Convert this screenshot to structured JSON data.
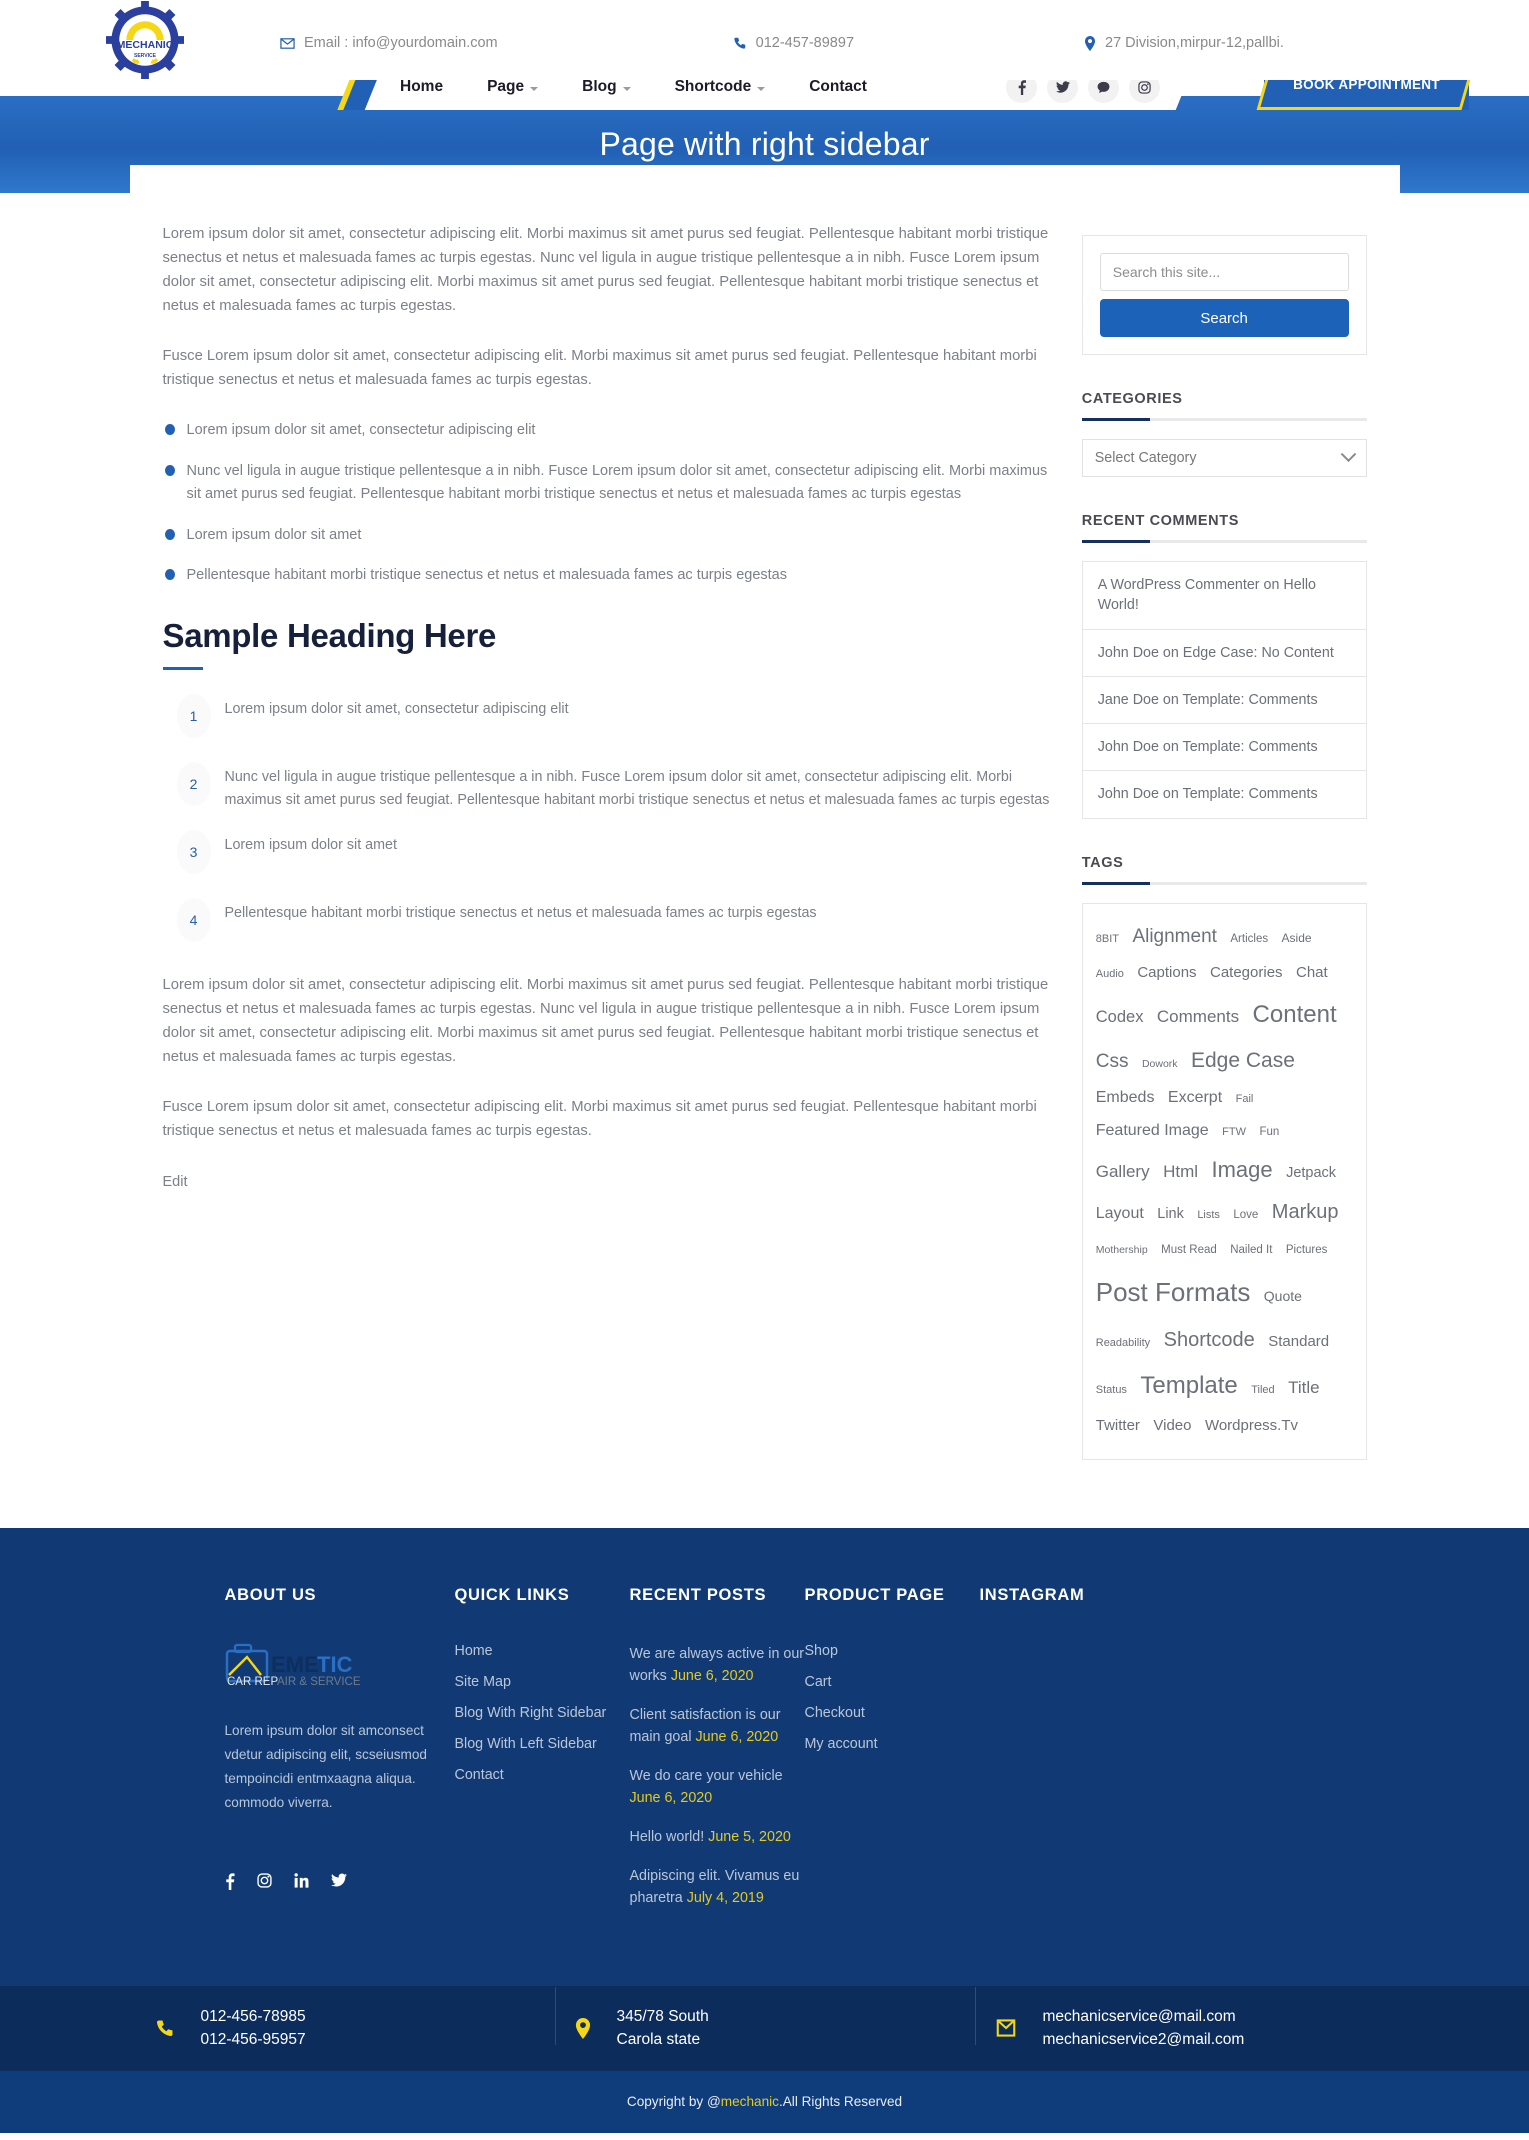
{
  "header": {
    "logo": {
      "brand": "MECHANIC",
      "sub": "SERVICE"
    },
    "contacts": [
      {
        "icon": "mail-icon",
        "text": "Email : info@yourdomain.com"
      },
      {
        "icon": "phone-icon",
        "text": "012-457-89897"
      },
      {
        "icon": "location-pin-icon",
        "text": "27 Division,mirpur-12,pallbi."
      }
    ],
    "nav": [
      {
        "label": "Home",
        "has_dropdown": false
      },
      {
        "label": "Page",
        "has_dropdown": true
      },
      {
        "label": "Blog",
        "has_dropdown": true
      },
      {
        "label": "Shortcode",
        "has_dropdown": true
      },
      {
        "label": "Contact",
        "has_dropdown": false
      }
    ],
    "social": [
      "facebook-icon",
      "twitter-icon",
      "comment-icon",
      "instagram-icon"
    ],
    "cta_label": "BOOK APPOINTMENT"
  },
  "banner": {
    "title": "Page with right sidebar"
  },
  "main": {
    "paragraphs": [
      "Lorem ipsum dolor sit amet, consectetur adipiscing elit. Morbi maximus sit amet purus sed feugiat. Pellentesque habitant morbi tristique senectus et netus et malesuada fames ac turpis egestas. Nunc vel ligula in augue tristique pellentesque a in nibh. Fusce Lorem ipsum dolor sit amet, consectetur adipiscing elit. Morbi maximus sit amet purus sed feugiat. Pellentesque habitant morbi tristique senectus et netus et malesuada fames ac turpis egestas.",
      "Fusce Lorem ipsum dolor sit amet, consectetur adipiscing elit. Morbi maximus sit amet purus sed feugiat. Pellentesque habitant morbi tristique senectus et netus et malesuada fames ac turpis egestas."
    ],
    "bullet_list": [
      "Lorem ipsum dolor sit amet, consectetur adipiscing elit",
      "Nunc vel ligula in augue tristique pellentesque a in nibh. Fusce Lorem ipsum dolor sit amet, consectetur adipiscing elit. Morbi maximus sit amet purus sed feugiat. Pellentesque habitant morbi tristique senectus et netus et malesuada fames ac turpis egestas",
      "Lorem ipsum dolor sit amet",
      "Pellentesque habitant morbi tristique senectus et netus et malesuada fames ac turpis egestas"
    ],
    "heading": "Sample Heading Here",
    "numbered_list": [
      {
        "num": "1",
        "text": "Lorem ipsum dolor sit amet, consectetur adipiscing elit"
      },
      {
        "num": "2",
        "text": "Nunc vel ligula in augue tristique pellentesque a in nibh. Fusce Lorem ipsum dolor sit amet, consectetur adipiscing elit. Morbi maximus sit amet purus sed feugiat. Pellentesque habitant morbi tristique senectus et netus et malesuada fames ac turpis egestas"
      },
      {
        "num": "3",
        "text": "Lorem ipsum dolor sit amet"
      },
      {
        "num": "4",
        "text": "Pellentesque habitant morbi tristique senectus et netus et malesuada fames ac turpis egestas"
      }
    ],
    "paragraphs_after": [
      "Lorem ipsum dolor sit amet, consectetur adipiscing elit. Morbi maximus sit amet purus sed feugiat. Pellentesque habitant morbi tristique senectus et netus et malesuada fames ac turpis egestas. Nunc vel ligula in augue tristique pellentesque a in nibh. Fusce Lorem ipsum dolor sit amet, consectetur adipiscing elit. Morbi maximus sit amet purus sed feugiat. Pellentesque habitant morbi tristique senectus et netus et malesuada fames ac turpis egestas.",
      "Fusce Lorem ipsum dolor sit amet, consectetur adipiscing elit. Morbi maximus sit amet purus sed feugiat. Pellentesque habitant morbi tristique senectus et netus et malesuada fames ac turpis egestas."
    ],
    "edit_label": "Edit"
  },
  "sidebar": {
    "search": {
      "placeholder": "Search this site...",
      "value": "",
      "button_label": "Search"
    },
    "categories": {
      "title": "CATEGORIES",
      "selected": "Select Category"
    },
    "recent_comments": {
      "title": "RECENT COMMENTS",
      "items": [
        "A WordPress Commenter on Hello World!",
        "John Doe on Edge Case: No Content",
        "Jane Doe on Template: Comments",
        "John Doe on Template: Comments",
        "John Doe on Template: Comments"
      ]
    },
    "tags": {
      "title": "TAGS",
      "items": [
        {
          "label": "8BIT",
          "size": 11
        },
        {
          "label": "Alignment",
          "size": 19
        },
        {
          "label": "Articles",
          "size": 11.5
        },
        {
          "label": "Aside",
          "size": 12
        },
        {
          "label": "Audio",
          "size": 11
        },
        {
          "label": "Captions",
          "size": 15
        },
        {
          "label": "Categories",
          "size": 15
        },
        {
          "label": "Chat",
          "size": 15
        },
        {
          "label": "Codex",
          "size": 16.5
        },
        {
          "label": "Comments",
          "size": 17
        },
        {
          "label": "Content",
          "size": 24
        },
        {
          "label": "Css",
          "size": 19
        },
        {
          "label": "Dowork",
          "size": 10.5
        },
        {
          "label": "Edge Case",
          "size": 21
        },
        {
          "label": "Embeds",
          "size": 16
        },
        {
          "label": "Excerpt",
          "size": 16
        },
        {
          "label": "Fail",
          "size": 11
        },
        {
          "label": "Featured Image",
          "size": 16
        },
        {
          "label": "FTW",
          "size": 11
        },
        {
          "label": "Fun",
          "size": 11.5
        },
        {
          "label": "Gallery",
          "size": 17
        },
        {
          "label": "Html",
          "size": 17
        },
        {
          "label": "Image",
          "size": 22
        },
        {
          "label": "Jetpack",
          "size": 14.5
        },
        {
          "label": "Layout",
          "size": 16
        },
        {
          "label": "Link",
          "size": 14.5
        },
        {
          "label": "Lists",
          "size": 11
        },
        {
          "label": "Love",
          "size": 11.5
        },
        {
          "label": "Markup",
          "size": 20
        },
        {
          "label": "Mothership",
          "size": 10.5
        },
        {
          "label": "Must Read",
          "size": 11.5
        },
        {
          "label": "Nailed It",
          "size": 11.5
        },
        {
          "label": "Pictures",
          "size": 11.5
        },
        {
          "label": "Post Formats",
          "size": 26
        },
        {
          "label": "Quote",
          "size": 14
        },
        {
          "label": "Readability",
          "size": 11
        },
        {
          "label": "Shortcode",
          "size": 20
        },
        {
          "label": "Standard",
          "size": 15
        },
        {
          "label": "Status",
          "size": 11
        },
        {
          "label": "Template",
          "size": 24
        },
        {
          "label": "Tiled",
          "size": 11
        },
        {
          "label": "Title",
          "size": 17
        },
        {
          "label": "Twitter",
          "size": 15
        },
        {
          "label": "Video",
          "size": 15
        },
        {
          "label": "Wordpress.Tv",
          "size": 15
        }
      ]
    }
  },
  "footer": {
    "about": {
      "title": "ABOUT US",
      "logo_main": "EMETIC",
      "logo_sub": "CAR REPAIR & SERVICE",
      "text": "Lorem ipsum dolor sit amconsect vdetur adipiscing elit, scseiusmod tempoincidi entmxaagna aliqua. commodo viverra.",
      "social": [
        "facebook-icon",
        "instagram-icon",
        "linkedin-icon",
        "twitter-icon"
      ]
    },
    "quick_links": {
      "title": "QUICK LINKS",
      "items": [
        "Home",
        "Site Map",
        "Blog With Right Sidebar",
        "Blog With Left Sidebar",
        "Contact"
      ]
    },
    "recent_posts": {
      "title": "RECENT POSTS",
      "items": [
        {
          "text": "We are always active in our works ",
          "date": "June 6, 2020"
        },
        {
          "text": "Client satisfaction is our main goal ",
          "date": "June 6, 2020"
        },
        {
          "text": "We do care your vehicle ",
          "date": "June 6, 2020"
        },
        {
          "text": "Hello world! ",
          "date": "June 5, 2020"
        },
        {
          "text": "Adipiscing elit. Vivamus eu pharetra ",
          "date": "July 4, 2019"
        }
      ]
    },
    "product_page": {
      "title": "PRODUCT PAGE",
      "items": [
        "Shop",
        "Cart",
        "Checkout",
        "My account"
      ]
    },
    "instagram": {
      "title": "INSTAGRAM"
    }
  },
  "contact_strip": [
    {
      "icon": "phone-icon",
      "line1": "012-456-78985",
      "line2": "012-456-95957"
    },
    {
      "icon": "location-pin-icon",
      "line1": "345/78 South",
      "line2": "Carola state"
    },
    {
      "icon": "mail-icon",
      "line1": "mechanicservice@mail.com",
      "line2": "mechanicservice2@mail.com"
    }
  ],
  "copyright": {
    "pre": "Copyright by @",
    "brand": "mechanic",
    "post": ".All Rights Reserved"
  },
  "colors": {
    "brand_blue": "#2160b4",
    "brand_yellow": "#f5d716",
    "footer_blue": "#113a74",
    "dark_blue": "#0c2c5c"
  }
}
